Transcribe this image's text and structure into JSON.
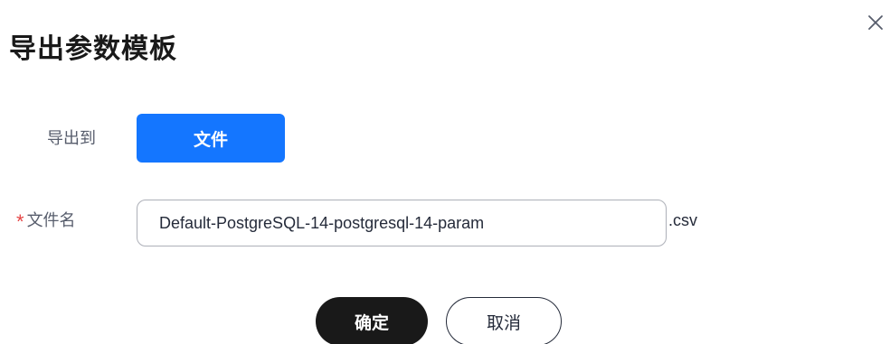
{
  "dialog": {
    "title": "导出参数模板",
    "close_icon": "close-icon"
  },
  "export_to": {
    "label": "导出到",
    "option_label": "文件"
  },
  "filename": {
    "required_mark": "*",
    "label": "文件名",
    "value": "Default-PostgreSQL-14-postgresql-14-param",
    "extension": ".csv"
  },
  "actions": {
    "ok_label": "确定",
    "cancel_label": "取消"
  },
  "colors": {
    "primary": "#1476ff",
    "required": "#e54545",
    "ok_button": "#191919"
  }
}
